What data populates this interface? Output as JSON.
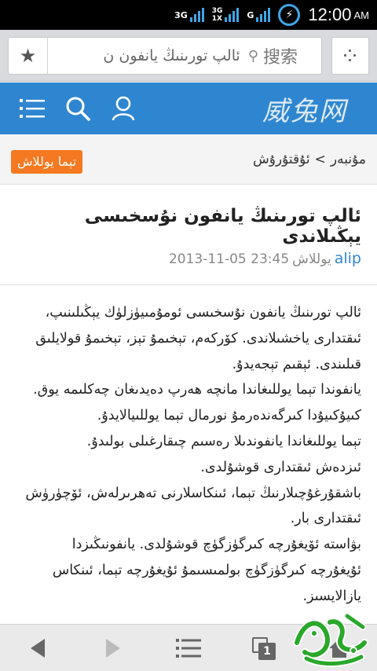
{
  "status_bar": {
    "network_1": "3G",
    "network_2": "3G",
    "network_2_sub": "1X",
    "network_3": "G",
    "time": "12:00",
    "ampm": "AM"
  },
  "browser": {
    "url_text": "ئالپ تورىنىڭ يانفون ن",
    "search_label": "搜索",
    "icons": {
      "favorite": "star-icon",
      "search": "search-icon",
      "menu": "grid-dots-icon"
    }
  },
  "site": {
    "logo": "威兔网",
    "icons": [
      "list-icon",
      "search-icon",
      "user-icon"
    ]
  },
  "breadcrumb": {
    "home": "مۇنبەر",
    "separator": ">",
    "section": "ئۇقتۇرۇش",
    "reply_button": "تېما يوللاش"
  },
  "post": {
    "title": "ئالپ تورىنىڭ يانفون نۇسخىسى يېڭىلاندى",
    "author": "alip",
    "posted_label": "يوللاش",
    "date": "2013-11-05 23:45",
    "body": [
      "ئالپ تورىنىڭ يانفون نۇسخىسى ئومۇمىيۈزلۈك يېڭىلىنىپ،",
      "ئىقتدارى ياخشىلاندى. كۆركەم، تېخىمۇ تېز، تېخىمۇ قولايلىق",
      "قىلىندى. ئېقىم تېجەيدۇ.",
      "يانفوندا تېما يوللىغاندا مانچە ھەرپ دەيدىغان چەكلىمە يوق.",
      "كىيۇكىيۇدا كىرگەندەرمۇ نورمال تېما يوللىيالايدۇ.",
      "تېما يوللىغاندا يانفوندىلا رەسىم چىقارغىلى بولىدۇ.",
      "ئىزدەش ئىقتدارى قوشۇلدى.",
      "باشقۇرغۇچىلارنىڭ تېما، ئىنكاسلارنى تەھرىرلەش، ئۆچۈرۈش",
      "ئىقتدارى بار.",
      "بۋاستە ئۆيغۇرچە كىرگۈزگۈچ قوشۇلدى. يانفونىڭىزدا",
      "ئۇيغۇرچە كىرگۈزگۈچ بولمىسىمۇ ئۇيغۇرچە تېما، ئىنكاس",
      "يازالايسىز."
    ]
  },
  "toolbar": {
    "tab_count": "1",
    "icons": [
      "back-arrow-icon",
      "forward-arrow-icon",
      "menu-icon",
      "tabs-icon",
      "home-icon"
    ]
  },
  "colors": {
    "header_blue": "#2f86d0",
    "reply_orange": "#f47920",
    "watermark_green": "#2aa82a"
  }
}
